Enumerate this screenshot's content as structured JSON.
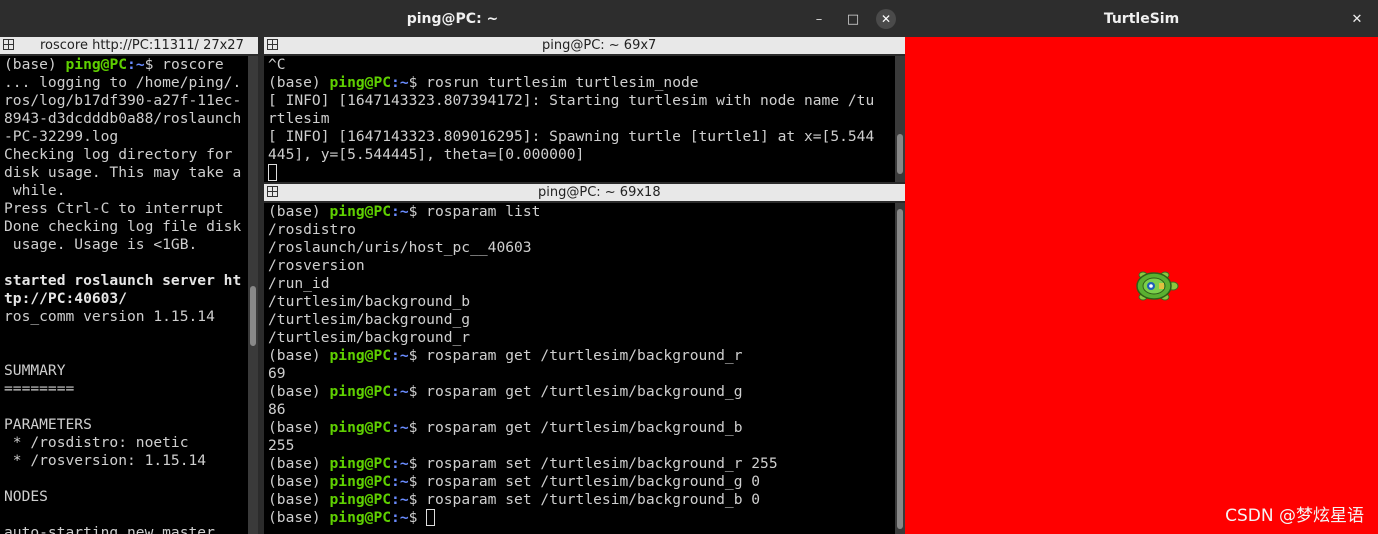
{
  "terminal_window": {
    "title": "ping@PC: ~",
    "minimize": "–",
    "maximize": "□",
    "close": "✕"
  },
  "left_pane": {
    "title": "roscore http://PC:11311/ 27x27"
  },
  "top_right_pane": {
    "title": "ping@PC: ~ 69x7"
  },
  "bottom_right_pane": {
    "title": "ping@PC: ~ 69x18"
  },
  "sim_window": {
    "title": "TurtleSim",
    "close": "✕",
    "background_color": "#ff0000",
    "watermark": "CSDN @梦炫星语"
  },
  "colors": {
    "prompt_user": "#5fd000",
    "prompt_path": "#6a8cff",
    "terminal_bg": "#000000",
    "terminal_fg": "#cfcfcf"
  },
  "roscore_lines": [
    {
      "pre": "(base) ",
      "user": "ping@PC",
      "path": ":~",
      "post": "$ roscore"
    },
    {
      "text": "... logging to /home/ping/."
    },
    {
      "text": "ros/log/b17df390-a27f-11ec-"
    },
    {
      "text": "8943-d3dcdddb0a88/roslaunch"
    },
    {
      "text": "-PC-32299.log"
    },
    {
      "text": "Checking log directory for"
    },
    {
      "text": "disk usage. This may take a"
    },
    {
      "text": " while."
    },
    {
      "text": "Press Ctrl-C to interrupt"
    },
    {
      "text": "Done checking log file disk"
    },
    {
      "text": " usage. Usage is <1GB."
    },
    {
      "text": ""
    },
    {
      "bold": "started roslaunch server ht"
    },
    {
      "bold": "tp://PC:40603/"
    },
    {
      "text": "ros_comm version 1.15.14"
    },
    {
      "text": ""
    },
    {
      "text": ""
    },
    {
      "text": "SUMMARY"
    },
    {
      "text": "========"
    },
    {
      "text": ""
    },
    {
      "text": "PARAMETERS"
    },
    {
      "text": " * /rosdistro: noetic"
    },
    {
      "text": " * /rosversion: 1.15.14"
    },
    {
      "text": ""
    },
    {
      "text": "NODES"
    },
    {
      "text": ""
    },
    {
      "text": "auto-starting new master"
    }
  ],
  "turtlesim_lines": [
    {
      "text": "^C"
    },
    {
      "pre": "(base) ",
      "user": "ping@PC",
      "path": ":~",
      "post": "$ rosrun turtlesim turtlesim_node"
    },
    {
      "text": "[ INFO] [1647143323.807394172]: Starting turtlesim with node name /tu"
    },
    {
      "text": "rtlesim"
    },
    {
      "text": "[ INFO] [1647143323.809016295]: Spawning turtle [turtle1] at x=[5.544"
    },
    {
      "text": "445], y=[5.544445], theta=[0.000000]"
    },
    {
      "cursor": true
    }
  ],
  "rosparam_lines": [
    {
      "pre": "(base) ",
      "user": "ping@PC",
      "path": ":~",
      "post": "$ rosparam list"
    },
    {
      "text": "/rosdistro"
    },
    {
      "text": "/roslaunch/uris/host_pc__40603"
    },
    {
      "text": "/rosversion"
    },
    {
      "text": "/run_id"
    },
    {
      "text": "/turtlesim/background_b"
    },
    {
      "text": "/turtlesim/background_g"
    },
    {
      "text": "/turtlesim/background_r"
    },
    {
      "pre": "(base) ",
      "user": "ping@PC",
      "path": ":~",
      "post": "$ rosparam get /turtlesim/background_r"
    },
    {
      "text": "69"
    },
    {
      "pre": "(base) ",
      "user": "ping@PC",
      "path": ":~",
      "post": "$ rosparam get /turtlesim/background_g"
    },
    {
      "text": "86"
    },
    {
      "pre": "(base) ",
      "user": "ping@PC",
      "path": ":~",
      "post": "$ rosparam get /turtlesim/background_b"
    },
    {
      "text": "255"
    },
    {
      "pre": "(base) ",
      "user": "ping@PC",
      "path": ":~",
      "post": "$ rosparam set /turtlesim/background_r 255"
    },
    {
      "pre": "(base) ",
      "user": "ping@PC",
      "path": ":~",
      "post": "$ rosparam set /turtlesim/background_g 0"
    },
    {
      "pre": "(base) ",
      "user": "ping@PC",
      "path": ":~",
      "post": "$ rosparam set /turtlesim/background_b 0"
    },
    {
      "pre": "(base) ",
      "user": "ping@PC",
      "path": ":~",
      "post": "$ ",
      "cursor": true
    }
  ]
}
